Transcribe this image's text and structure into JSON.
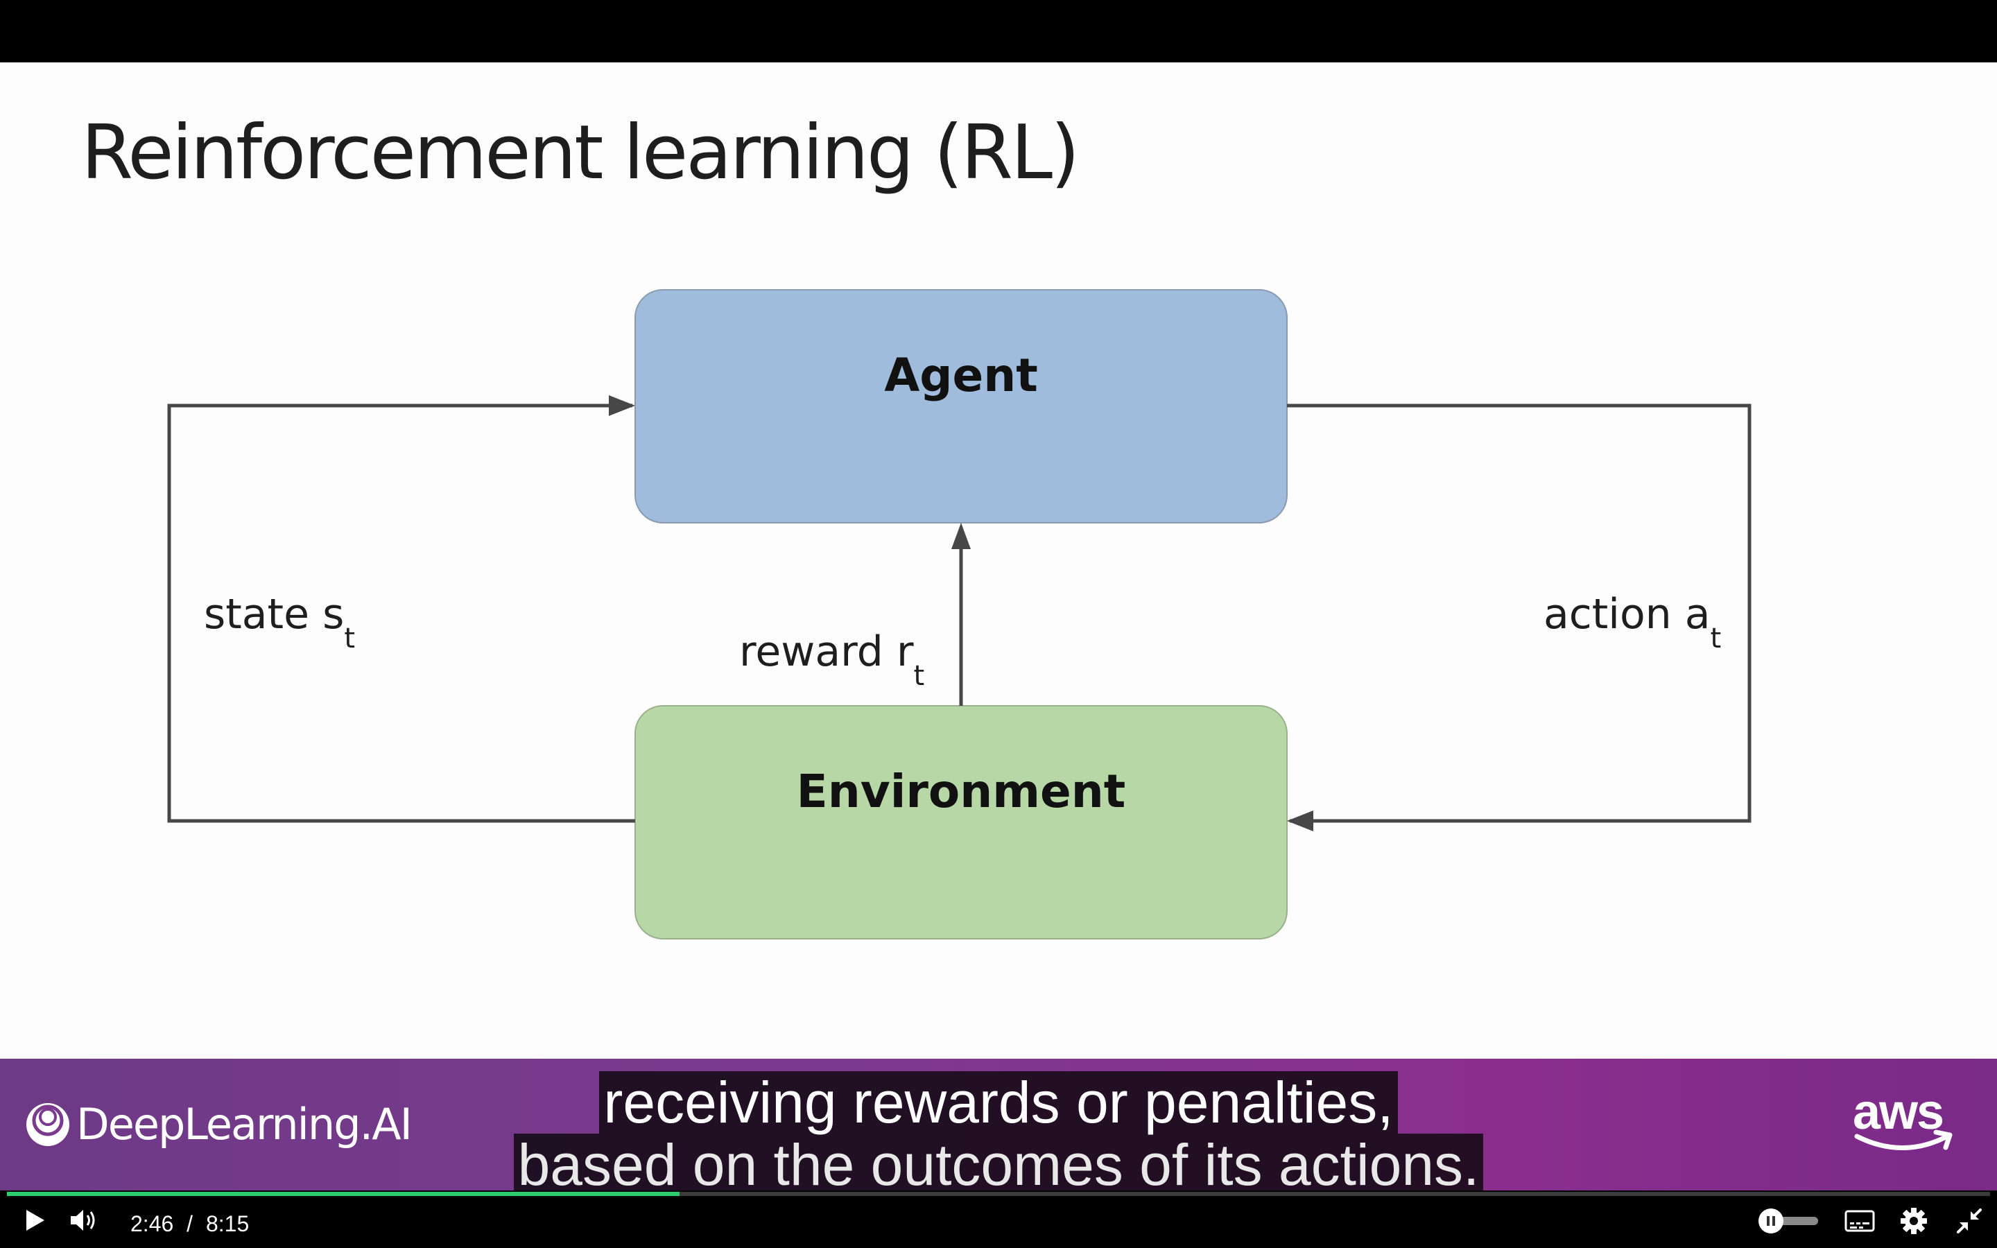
{
  "slide": {
    "title": "Reinforcement learning (RL)",
    "agent_label": "Agent",
    "environment_label": "Environment",
    "state_label": "state s",
    "state_sub": "t",
    "reward_label": "reward r",
    "reward_sub": "t",
    "action_label": "action a",
    "action_sub": "t",
    "colors": {
      "agent_fill": "#a0bcdc",
      "environment_fill": "#b7d8a6",
      "arrow": "#474747"
    }
  },
  "banner": {
    "logo_text": "DeepLearning.AI",
    "partner_logo": "aws"
  },
  "captions": {
    "line1": "receiving rewards or penalties,",
    "line2": "based on the outcomes of its actions."
  },
  "player": {
    "current_time": "2:46",
    "separator": "/",
    "duration": "8:15",
    "progress_fraction": 0.339,
    "progress_color": "#2ecc71",
    "icons": [
      "play-icon",
      "volume-icon",
      "autoplay-toggle-icon",
      "captions-icon",
      "settings-gear-icon",
      "exit-fullscreen-icon"
    ]
  }
}
